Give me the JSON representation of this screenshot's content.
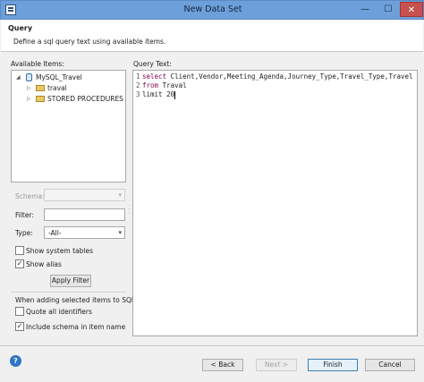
{
  "window": {
    "title": "New Data Set",
    "min_glyph": "—",
    "max_glyph": "☐",
    "close_glyph": "✕"
  },
  "header": {
    "title": "Query",
    "description": "Define a sql query text using available items."
  },
  "left": {
    "available_items_label": "Available Items:",
    "tree": {
      "root": "MySQL_Travel",
      "children": [
        "traval",
        "STORED PROCEDURES"
      ]
    },
    "schema_label": "Schema:",
    "schema_value": "",
    "filter_label": "Filter:",
    "filter_value": "",
    "type_label": "Type:",
    "type_value": "-All-",
    "show_system_tables_label": "Show system tables",
    "show_system_tables_checked": false,
    "show_alias_label": "Show alias",
    "show_alias_checked": true,
    "apply_filter_label": "Apply Filter",
    "adding_items_label": "When adding selected items to SQL",
    "quote_identifiers_label": "Quote all identifiers",
    "quote_identifiers_checked": false,
    "include_schema_label": "Include schema in item name",
    "include_schema_checked": true
  },
  "query": {
    "label": "Query Text:",
    "lines": [
      {
        "num": "1",
        "keyword": "select",
        "rest": " Client,Vendor,Meeting_Agenda,Journey_Type,Travel_Type,Travel"
      },
      {
        "num": "2",
        "keyword": "from",
        "rest": " Traval"
      },
      {
        "num": "3",
        "keyword": "",
        "rest": "limit 20"
      }
    ]
  },
  "footer": {
    "help_glyph": "?",
    "back_label": "< Back",
    "next_label": "Next >",
    "finish_label": "Finish",
    "cancel_label": "Cancel"
  },
  "colors": {
    "titlebar": "#6da0da",
    "close_button": "#c75050",
    "keyword": "#7f0055"
  }
}
